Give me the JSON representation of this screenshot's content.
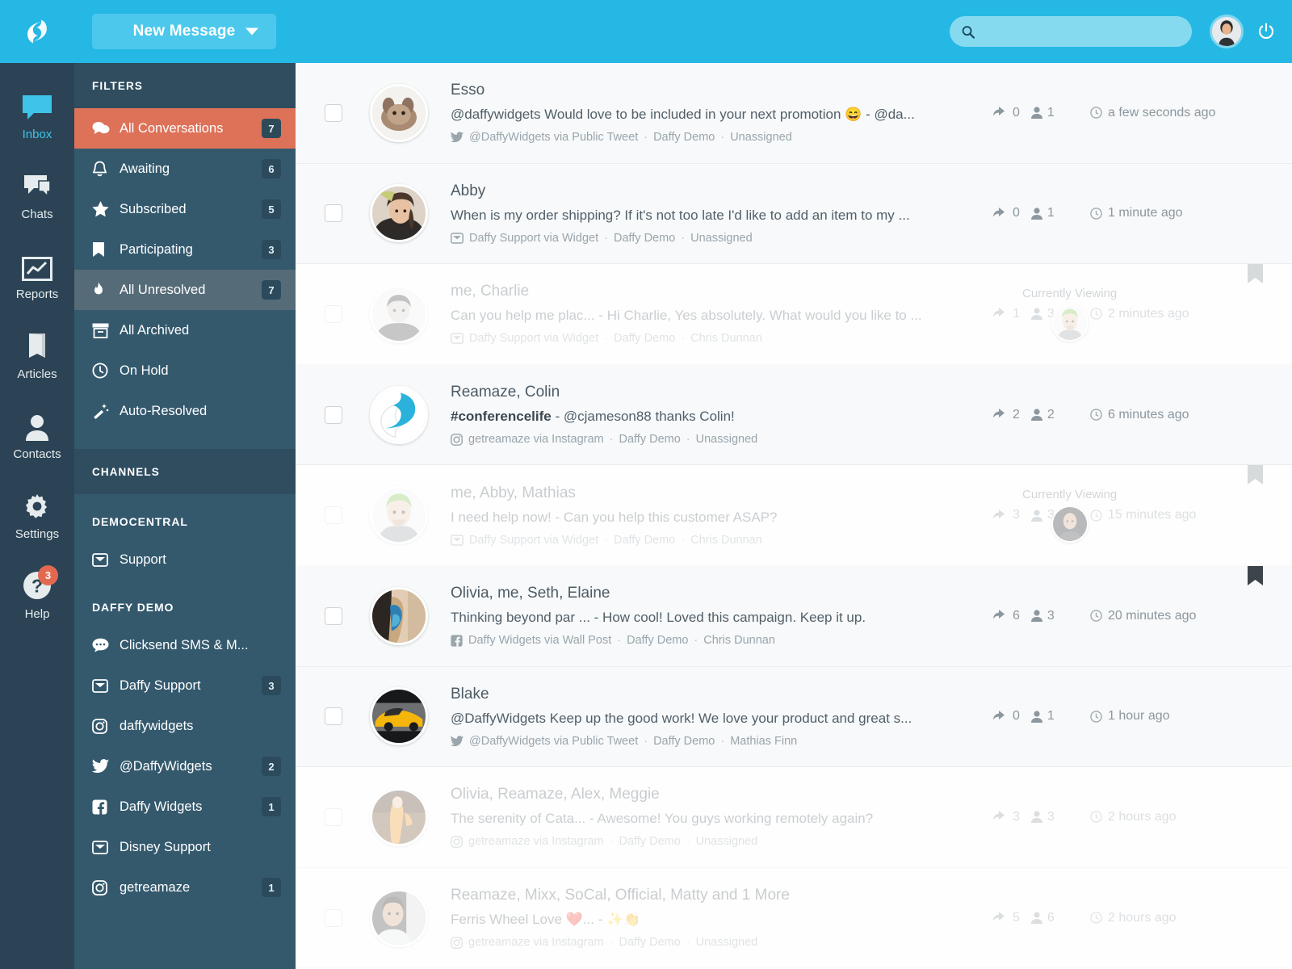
{
  "topbar": {
    "logo_icon": "reamaze-leaf-logo",
    "new_message_label": "New Message",
    "new_message_caret_icon": "chevron-down-icon",
    "search_icon": "search-icon",
    "search_value": "",
    "search_placeholder": "",
    "avatar_icon": "user-avatar",
    "power_icon": "power-icon",
    "accent_color": "#26b8e4",
    "button_color": "#4cc8ec"
  },
  "rail": {
    "items": [
      {
        "label": "Inbox",
        "icon": "inbox-speech-bubble-icon",
        "active": true
      },
      {
        "label": "Chats",
        "icon": "chats-bubbles-icon",
        "active": false
      },
      {
        "label": "Reports",
        "icon": "reports-chart-icon",
        "active": false
      },
      {
        "label": "Articles",
        "icon": "articles-book-icon",
        "active": false
      },
      {
        "label": "Contacts",
        "icon": "contacts-person-icon",
        "active": false
      },
      {
        "label": "Settings",
        "icon": "gear-icon",
        "active": false
      },
      {
        "label": "Help",
        "icon": "question-circle-icon",
        "active": false,
        "badge": "3"
      }
    ],
    "bg_color": "#2b4355",
    "active_color": "#3fc3e8",
    "badge_color": "#e2694f"
  },
  "sidebar": {
    "filters_header": "FILTERS",
    "filters": [
      {
        "label": "All Conversations",
        "icon": "conversations-icon",
        "badge": "7",
        "state": "active-orange"
      },
      {
        "label": "Awaiting",
        "icon": "bell-icon",
        "badge": "6",
        "state": ""
      },
      {
        "label": "Subscribed",
        "icon": "star-icon",
        "badge": "5",
        "state": ""
      },
      {
        "label": "Participating",
        "icon": "bookmark-icon",
        "badge": "3",
        "state": ""
      },
      {
        "label": "All Unresolved",
        "icon": "flame-icon",
        "badge": "7",
        "state": "active-grey"
      },
      {
        "label": "All Archived",
        "icon": "archive-icon",
        "badge": "",
        "state": ""
      },
      {
        "label": "On Hold",
        "icon": "clock-icon",
        "badge": "",
        "state": ""
      },
      {
        "label": "Auto-Resolved",
        "icon": "magic-wand-icon",
        "badge": "",
        "state": ""
      }
    ],
    "channels_header": "CHANNELS",
    "groups": [
      {
        "title": "DEMOCENTRAL",
        "items": [
          {
            "label": "Support",
            "icon": "inbox-tray-icon",
            "badge": ""
          }
        ]
      },
      {
        "title": "DAFFY DEMO",
        "items": [
          {
            "label": "Clicksend SMS & M...",
            "icon": "sms-bubble-icon",
            "badge": ""
          },
          {
            "label": "Daffy Support",
            "icon": "inbox-tray-icon",
            "badge": "3"
          },
          {
            "label": "daffywidgets",
            "icon": "instagram-icon",
            "badge": ""
          },
          {
            "label": "@DaffyWidgets",
            "icon": "twitter-icon",
            "badge": "2"
          },
          {
            "label": "Daffy Widgets",
            "icon": "facebook-icon",
            "badge": "1"
          },
          {
            "label": "Disney Support",
            "icon": "inbox-tray-icon",
            "badge": ""
          },
          {
            "label": "getreamaze",
            "icon": "instagram-icon",
            "badge": "1"
          }
        ]
      }
    ],
    "bg_color": "#34596d",
    "active_orange": "#dd7259",
    "active_grey": "#566b78"
  },
  "conversations": [
    {
      "title": "Esso",
      "snippet": "@daffywidgets Would love to be included in your next promotion 😄 - @da...",
      "snippet_bold": "",
      "channel_icon": "twitter-icon",
      "channel": "@DaffyWidgets via Public Tweet",
      "brand": "Daffy Demo",
      "assignee": "Unassigned",
      "replies": "0",
      "people": "1",
      "time": "a few seconds ago",
      "avatar": "rabbit-photo",
      "dim": false,
      "flagged": false,
      "viewing": null
    },
    {
      "title": "Abby",
      "snippet": "When is my order shipping? If it's not too late I'd like to add an item to my ...",
      "snippet_bold": "",
      "channel_icon": "inbox-tray-icon",
      "channel": "Daffy Support via Widget",
      "brand": "Daffy Demo",
      "assignee": "Unassigned",
      "replies": "0",
      "people": "1",
      "time": "1 minute ago",
      "avatar": "woman-photo",
      "dim": false,
      "flagged": false,
      "viewing": null
    },
    {
      "title": "me, Charlie",
      "snippet": "Can you help me plac... - Hi Charlie, Yes absolutely. What would you like to ...",
      "snippet_bold": "",
      "channel_icon": "inbox-tray-icon",
      "channel": "Daffy Support via Widget",
      "brand": "Daffy Demo",
      "assignee": "Chris Dunnan",
      "replies": "1",
      "people": "3",
      "time": "2 minutes ago",
      "avatar": "man-grey-photo",
      "dim": true,
      "flagged": true,
      "viewing": {
        "label": "Currently Viewing",
        "avatar": "green-hair-avatar"
      }
    },
    {
      "title": "Reamaze, Colin",
      "snippet": "#conferencelife - @cjameson88 thanks Colin!",
      "snippet_bold": "#conferencelife",
      "channel_icon": "instagram-icon",
      "channel": "getreamaze via Instagram",
      "brand": "Daffy Demo",
      "assignee": "Unassigned",
      "replies": "2",
      "people": "2",
      "time": "6 minutes ago",
      "avatar": "reamaze-logo",
      "dim": false,
      "flagged": false,
      "viewing": null
    },
    {
      "title": "me, Abby, Mathias",
      "snippet": "I need help now! - Can you help this customer ASAP?",
      "snippet_bold": "",
      "channel_icon": "inbox-tray-icon",
      "channel": "Daffy Support via Widget",
      "brand": "Daffy Demo",
      "assignee": "Chris Dunnan",
      "replies": "3",
      "people": "3",
      "time": "15 minutes ago",
      "avatar": "green-hair-avatar",
      "dim": true,
      "flagged": true,
      "viewing": {
        "label": "Currently Viewing",
        "avatar": "dark-man-photo"
      }
    },
    {
      "title": "Olivia, me, Seth, Elaine",
      "snippet": "Thinking beyond par ... - How cool! Loved this campaign. Keep it up.",
      "snippet_bold": "",
      "channel_icon": "facebook-icon",
      "channel": "Daffy Widgets via Wall Post",
      "brand": "Daffy Demo",
      "assignee": "Chris Dunnan",
      "replies": "6",
      "people": "3",
      "time": "20 minutes ago",
      "avatar": "woman-scarf-photo",
      "dim": false,
      "flagged": true,
      "viewing": null
    },
    {
      "title": "Blake",
      "snippet": "@DaffyWidgets Keep up the good work! We love your product and great s...",
      "snippet_bold": "",
      "channel_icon": "twitter-icon",
      "channel": "@DaffyWidgets via Public Tweet",
      "brand": "Daffy Demo",
      "assignee": "Mathias Finn",
      "replies": "0",
      "people": "1",
      "time": "1 hour ago",
      "avatar": "yellow-car-photo",
      "dim": false,
      "flagged": false,
      "viewing": null
    },
    {
      "title": "Olivia, Reamaze, Alex, Meggie",
      "snippet": "The serenity of Cata... - Awesome! You guys working remotely again?",
      "snippet_bold": "",
      "channel_icon": "instagram-icon",
      "channel": "getreamaze via Instagram",
      "brand": "Daffy Demo",
      "assignee": "Unassigned",
      "replies": "3",
      "people": "3",
      "time": "2 hours ago",
      "avatar": "orange-jacket-photo",
      "dim": true,
      "flagged": false,
      "viewing": null
    },
    {
      "title": "Reamaze, Mixx, SoCal, Official, Matty and 1 More",
      "snippet": "Ferris Wheel Love ❤️... - ✨👏",
      "snippet_bold": "",
      "channel_icon": "instagram-icon",
      "channel": "getreamaze via Instagram",
      "brand": "Daffy Demo",
      "assignee": "Unassigned",
      "replies": "5",
      "people": "6",
      "time": "2 hours ago",
      "avatar": "man-racing-photo",
      "dim": true,
      "flagged": false,
      "viewing": null
    }
  ]
}
